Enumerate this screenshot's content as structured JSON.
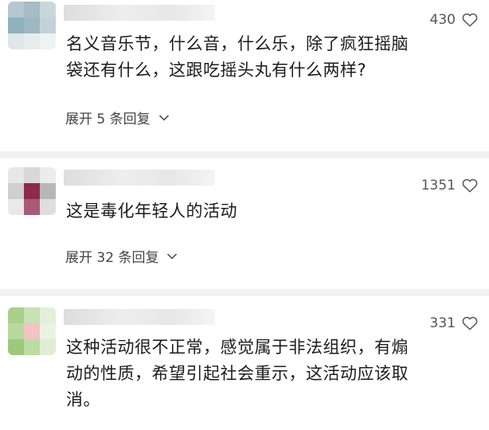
{
  "comments": [
    {
      "likes": "430",
      "text": "名义音乐节，什么音，什么乐，除了疯狂摇脑\n袋还有什么，这跟吃摇头丸有什么两样?",
      "replies_label": "展开 5 条回复"
    },
    {
      "likes": "1351",
      "text": "这是毒化年轻人的活动",
      "replies_label": "展开 32 条回复"
    },
    {
      "likes": "331",
      "text": "这种活动很不正常，感觉属于非法组织，有煽\n动的性质，希望引起社会重示，这活动应该取\n消。"
    }
  ],
  "colors": {
    "divider": "#f2f2f2",
    "text": "#1c1c1c",
    "meta": "#555555"
  },
  "icons": {
    "like": "heart-outline-icon",
    "expand": "chevron-down-icon"
  }
}
